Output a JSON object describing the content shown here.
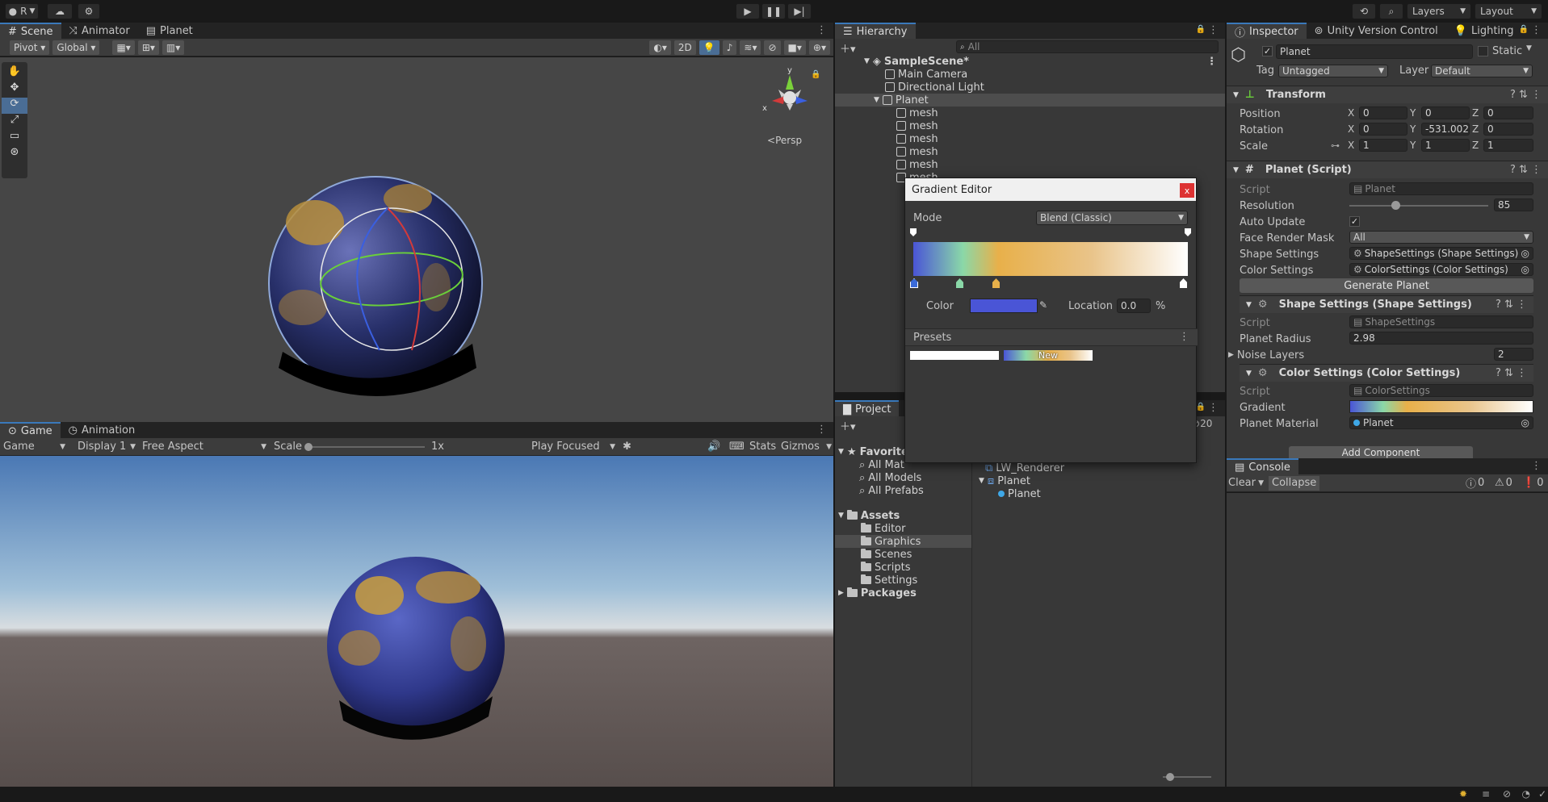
{
  "topbar": {
    "account_label": "R",
    "layers_label": "Layers",
    "layout_label": "Layout"
  },
  "scene_tabs": [
    "Scene",
    "Animator",
    "Planet"
  ],
  "scene_toolbar": {
    "pivot": "Pivot",
    "global": "Global",
    "mode_2d": "2D"
  },
  "scene_view": {
    "persp_label": "Persp",
    "axis_y": "y",
    "axis_x": "x"
  },
  "game_tabs": [
    "Game",
    "Animation"
  ],
  "game_toolbar": {
    "view": "Game",
    "display": "Display 1",
    "aspect": "Free Aspect",
    "scale_label": "Scale",
    "scale_value": "1x",
    "play_mode": "Play Focused",
    "stats": "Stats",
    "gizmos": "Gizmos"
  },
  "hierarchy": {
    "tab": "Hierarchy",
    "search_placeholder": "All",
    "scene": "SampleScene*",
    "items": [
      "Main Camera",
      "Directional Light",
      "Planet"
    ],
    "children": [
      "mesh",
      "mesh",
      "mesh",
      "mesh",
      "mesh",
      "mesh"
    ]
  },
  "gradient_editor": {
    "title": "Gradient Editor",
    "mode_label": "Mode",
    "mode_value": "Blend (Classic)",
    "color_label": "Color",
    "location_label": "Location",
    "location_value": "0.0",
    "location_unit": "%",
    "presets_label": "Presets",
    "preset_new": "New",
    "color_hex": "#4a55d6",
    "close": "x"
  },
  "project": {
    "tab": "Project",
    "favorites": "Favorites",
    "fav_items": [
      "All Mat",
      "All Models",
      "All Prefabs"
    ],
    "assets": "Assets",
    "asset_folders": [
      "Editor",
      "Graphics",
      "Scenes",
      "Scripts",
      "Settings"
    ],
    "packages": "Packages",
    "count": "20",
    "right_items": [
      "LW_Renderer",
      "Planet",
      "Planet"
    ]
  },
  "inspector": {
    "tabs": [
      "Inspector",
      "Unity Version Control",
      "Lighting"
    ],
    "object_name": "Planet",
    "static_label": "Static",
    "tag_label": "Tag",
    "tag_value": "Untagged",
    "layer_label": "Layer",
    "layer_value": "Default",
    "transform": {
      "title": "Transform",
      "position_label": "Position",
      "rotation_label": "Rotation",
      "scale_label": "Scale",
      "position": [
        "0",
        "0",
        "0"
      ],
      "rotation": [
        "0",
        "-531.002",
        "0"
      ],
      "scale": [
        "1",
        "1",
        "1"
      ],
      "axes": [
        "X",
        "Y",
        "Z"
      ]
    },
    "planet_script": {
      "title": "Planet (Script)",
      "script_label": "Script",
      "script_value": "Planet",
      "resolution_label": "Resolution",
      "resolution_value": "85",
      "auto_update_label": "Auto Update",
      "face_mask_label": "Face Render Mask",
      "face_mask_value": "All",
      "shape_settings_label": "Shape Settings",
      "shape_settings_value": "ShapeSettings (Shape Settings)",
      "color_settings_label": "Color Settings",
      "color_settings_value": "ColorSettings (Color Settings)",
      "generate_button": "Generate Planet"
    },
    "shape_settings": {
      "title": "Shape Settings (Shape Settings)",
      "script_label": "Script",
      "script_value": "ShapeSettings",
      "radius_label": "Planet Radius",
      "radius_value": "2.98",
      "noise_label": "Noise Layers",
      "noise_value": "2"
    },
    "color_settings": {
      "title": "Color Settings (Color Settings)",
      "script_label": "Script",
      "script_value": "ColorSettings",
      "gradient_label": "Gradient",
      "material_label": "Planet Material",
      "material_value": "Planet"
    },
    "add_component": "Add Component"
  },
  "console": {
    "tab": "Console",
    "clear": "Clear",
    "collapse": "Collapse",
    "counts": [
      "0",
      "0",
      "0"
    ]
  }
}
